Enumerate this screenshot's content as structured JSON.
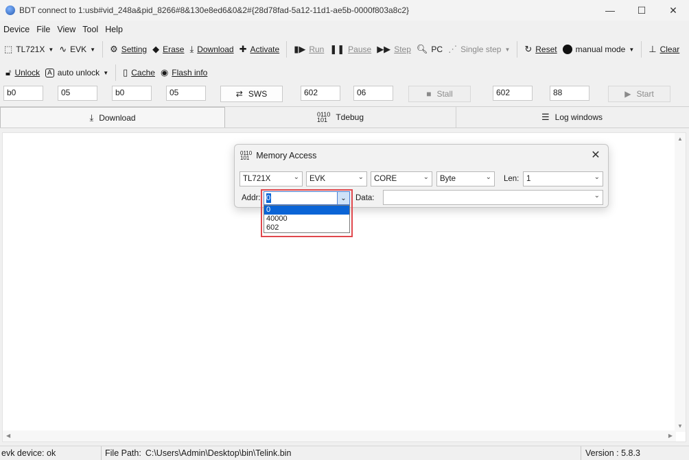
{
  "window": {
    "title": "BDT connect to 1:usb#vid_248a&pid_8266#8&130e8ed6&0&2#{28d78fad-5a12-11d1-ae5b-0000f803a8c2}",
    "minimize": "—",
    "maximize": "☐",
    "close": "✕"
  },
  "menu": [
    "Device",
    "File",
    "View",
    "Tool",
    "Help"
  ],
  "toolbar1": {
    "chip": "TL721X",
    "board": "EVK",
    "setting": "Setting",
    "erase": "Erase",
    "download": "Download",
    "activate": "Activate",
    "run": "Run",
    "pause": "Pause",
    "step": "Step",
    "pc": "PC",
    "single_step": "Single step",
    "reset": "Reset",
    "mode": "manual mode",
    "clear": "Clear"
  },
  "toolbar2": {
    "unlock": "Unlock",
    "auto_unlock": "auto unlock",
    "cache": "Cache",
    "flash_info": "Flash info"
  },
  "fields": {
    "f1": "b0",
    "f2": "05",
    "f3": "b0",
    "f4": "05",
    "sws": "SWS",
    "f5": "602",
    "f6": "06",
    "stall": "Stall",
    "f7": "602",
    "f8": "88",
    "start": "Start"
  },
  "tabs": {
    "download": "Download",
    "tdebug": "Tdebug",
    "log": "Log windows"
  },
  "dialog": {
    "title": "Memory Access",
    "chip": "TL721X",
    "board": "EVK",
    "core": "CORE",
    "unit": "Byte",
    "len_label": "Len:",
    "len_value": "1",
    "addr_label": "Addr:",
    "addr_value": "0",
    "data_label": "Data:",
    "addr_options": [
      "0",
      "40000",
      "602"
    ]
  },
  "status": {
    "device": "evk device: ok",
    "file_path_label": "File Path:",
    "file_path": "C:\\Users\\Admin\\Desktop\\bin\\Telink.bin",
    "version": "Version : 5.8.3"
  },
  "colors": {
    "selection": "#0a64d6",
    "highlight_border": "#e0474c"
  }
}
